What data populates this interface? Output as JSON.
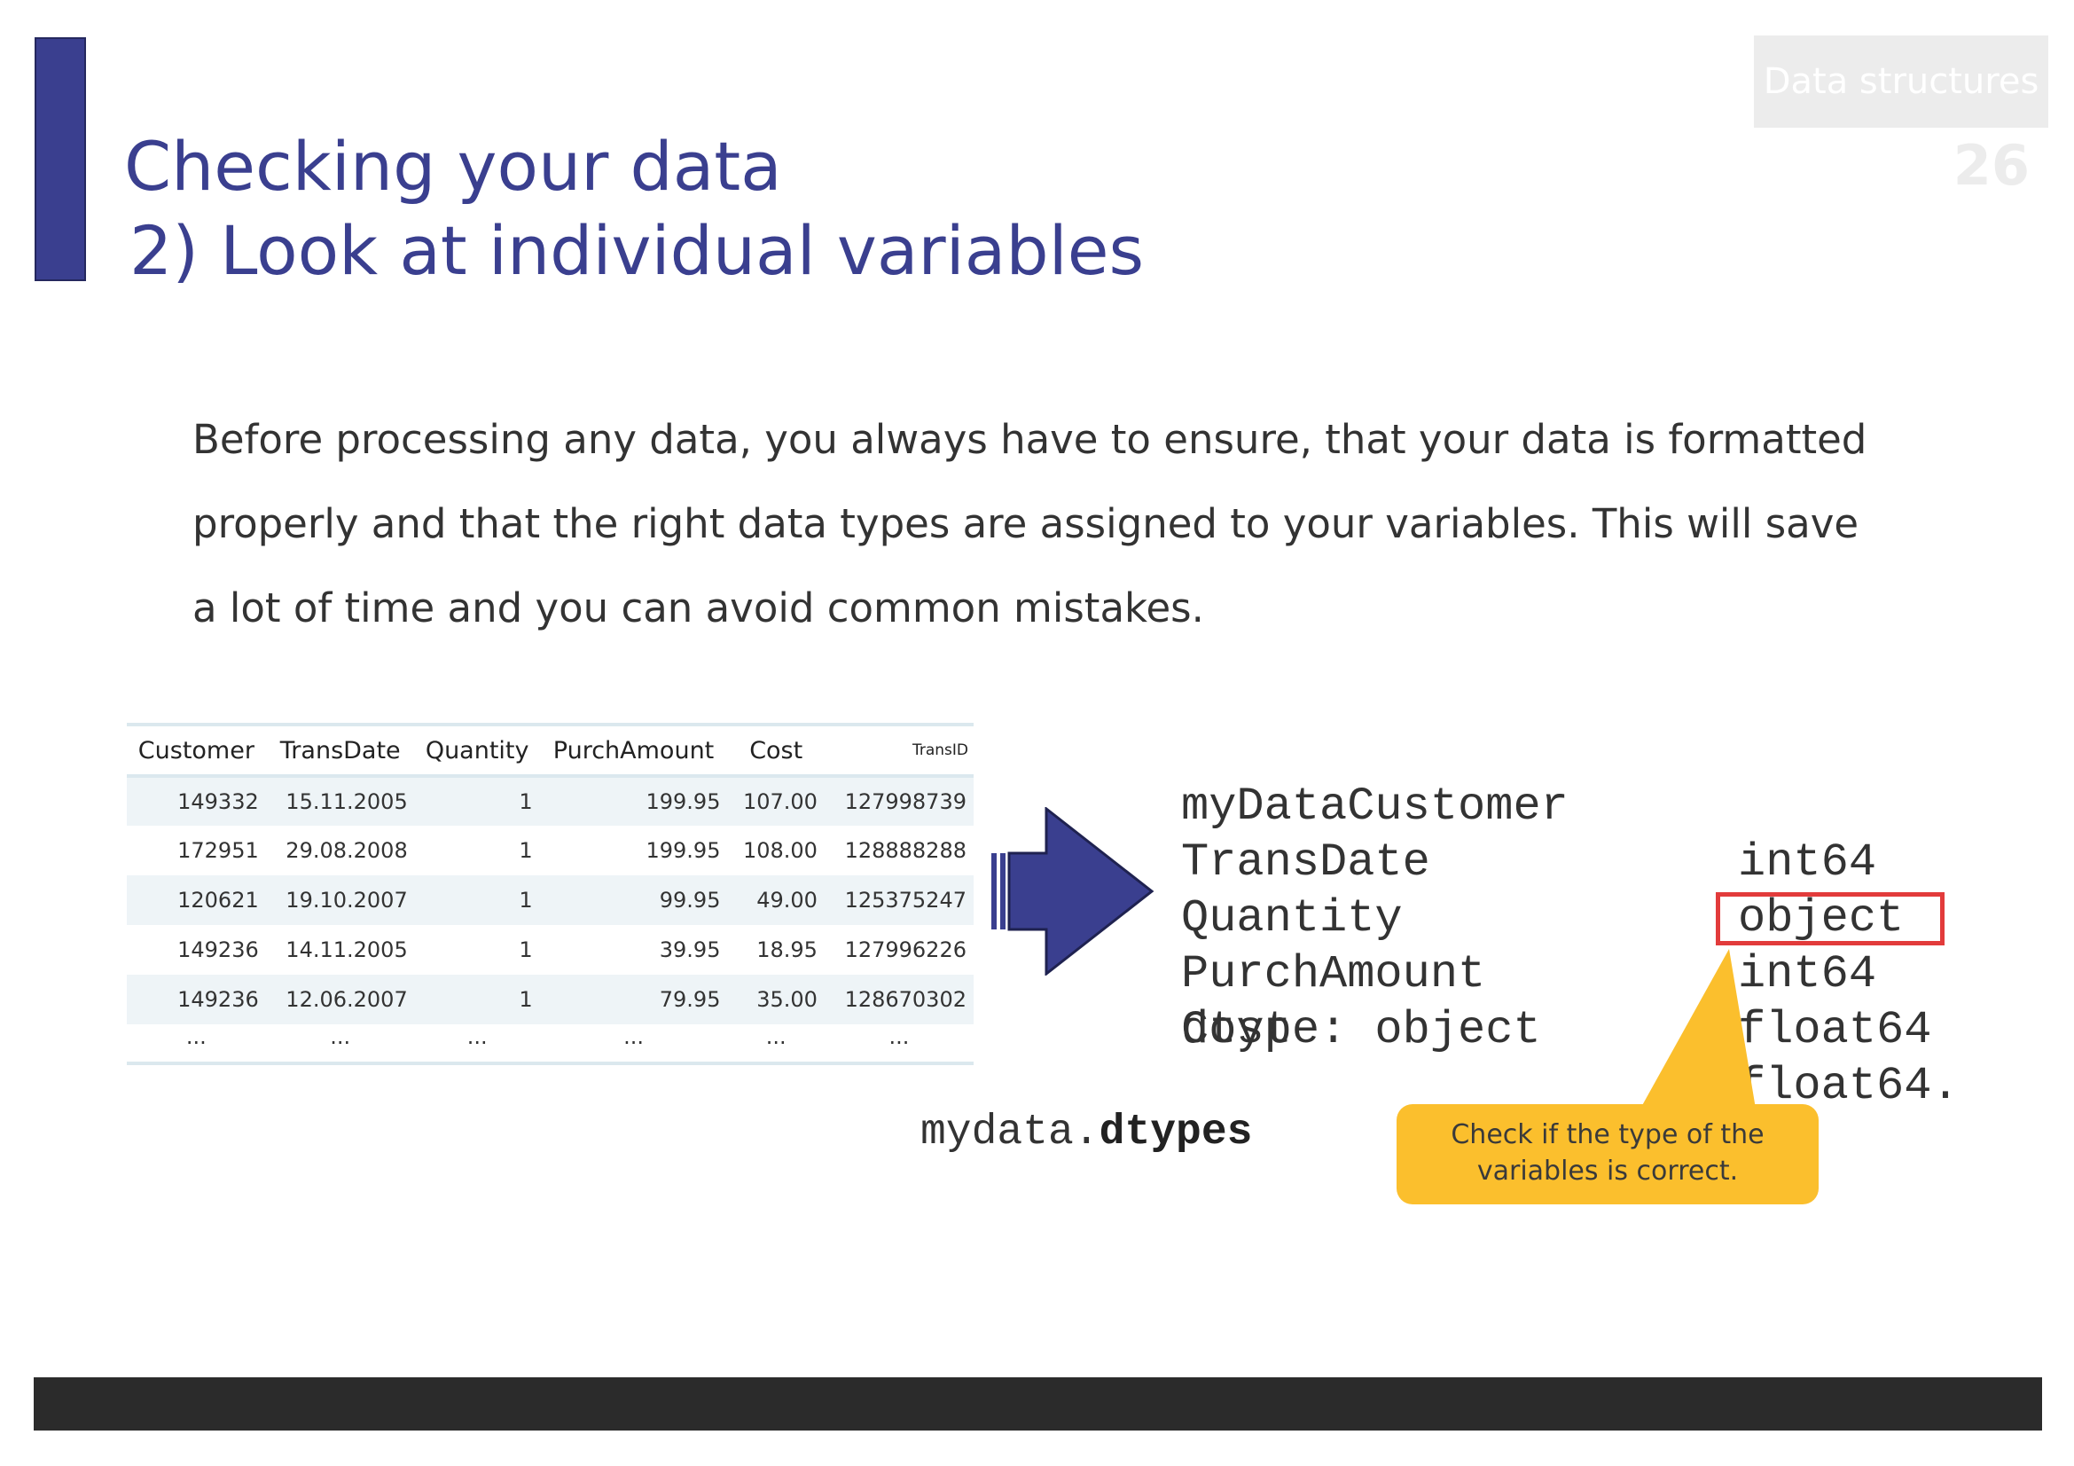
{
  "header": {
    "title_line1": "Checking your data",
    "title_line2": "2) Look at individual variables",
    "section": "Data structures",
    "page_number": "26"
  },
  "intro_text": "Before processing any data, you always have to ensure, that your data is formatted properly and that the right data types are assigned to your variables. This will save a lot of time and you can avoid common mistakes.",
  "table": {
    "columns": [
      "Customer",
      "TransDate",
      "Quantity",
      "PurchAmount",
      "Cost",
      "TransID"
    ],
    "rows": [
      [
        "149332",
        "15.11.2005",
        "1",
        "199.95",
        "107.00",
        "127998739"
      ],
      [
        "172951",
        "29.08.2008",
        "1",
        "199.95",
        "108.00",
        "128888288"
      ],
      [
        "120621",
        "19.10.2007",
        "1",
        "99.95",
        "49.00",
        "125375247"
      ],
      [
        "149236",
        "14.11.2005",
        "1",
        "39.95",
        "18.95",
        "127996226"
      ],
      [
        "149236",
        "12.06.2007",
        "1",
        "79.95",
        "35.00",
        "128670302"
      ]
    ],
    "ellipsis": "..."
  },
  "dtypes_output": [
    {
      "name": "myDataCustomer",
      "type": "int64"
    },
    {
      "name": "TransDate",
      "type": "object"
    },
    {
      "name": "Quantity",
      "type": "int64"
    },
    {
      "name": "PurchAmount",
      "type": "float64"
    },
    {
      "name": "Cost",
      "type": "float64."
    }
  ],
  "dtype_footer": "dtype: object",
  "code": {
    "prefix": "mydata.",
    "method": "dtypes"
  },
  "callout_text": "Check if the type of the variables is correct.",
  "colors": {
    "accent": "#3a3f8f",
    "highlight": "#e23b3b",
    "callout": "#fbbf2d",
    "footer": "#2b2b2b"
  }
}
